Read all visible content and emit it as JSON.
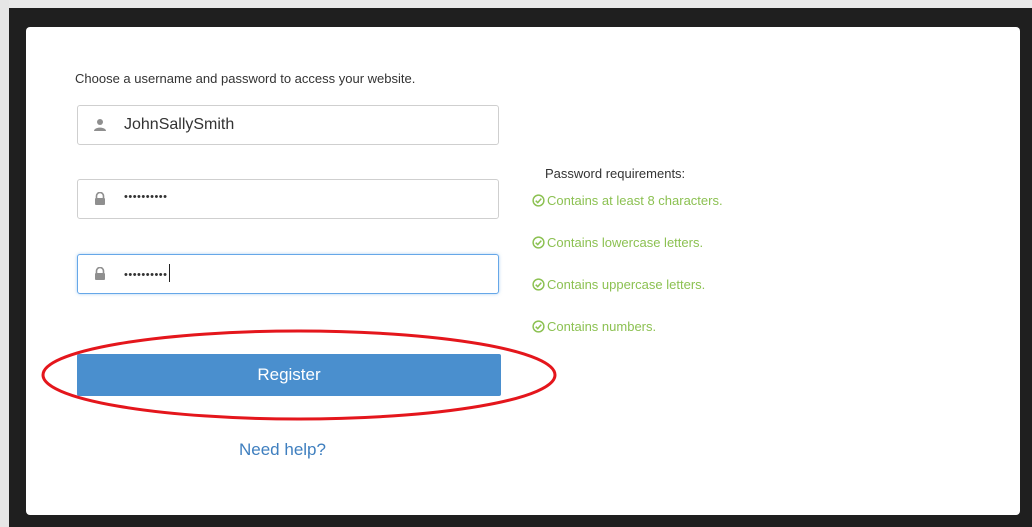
{
  "form": {
    "instruction": "Choose a username and password to access your website.",
    "username": {
      "value": "JohnSallySmith",
      "icon": "user-icon"
    },
    "password": {
      "masked_value": "••••••••••",
      "icon": "lock-icon"
    },
    "confirm_password": {
      "masked_value": "••••••••••",
      "icon": "lock-icon",
      "focused": true
    },
    "register_label": "Register",
    "help_link": "Need help?"
  },
  "requirements": {
    "title": "Password requirements:",
    "items": [
      {
        "label": "Contains at least 8 characters.",
        "met": true,
        "icon": "check-circle-icon"
      },
      {
        "label": "Contains lowercase letters.",
        "met": true,
        "icon": "check-circle-icon"
      },
      {
        "label": "Contains uppercase letters.",
        "met": true,
        "icon": "check-circle-icon"
      },
      {
        "label": "Contains numbers.",
        "met": true,
        "icon": "check-circle-icon"
      }
    ]
  },
  "colors": {
    "primary_button": "#4a8fce",
    "requirement_met": "#8cc152",
    "link": "#3f7fbf",
    "annotation": "#e4161c",
    "focus_border": "#66a7e8"
  },
  "annotation": {
    "shape": "ellipse",
    "target": "register-button"
  }
}
